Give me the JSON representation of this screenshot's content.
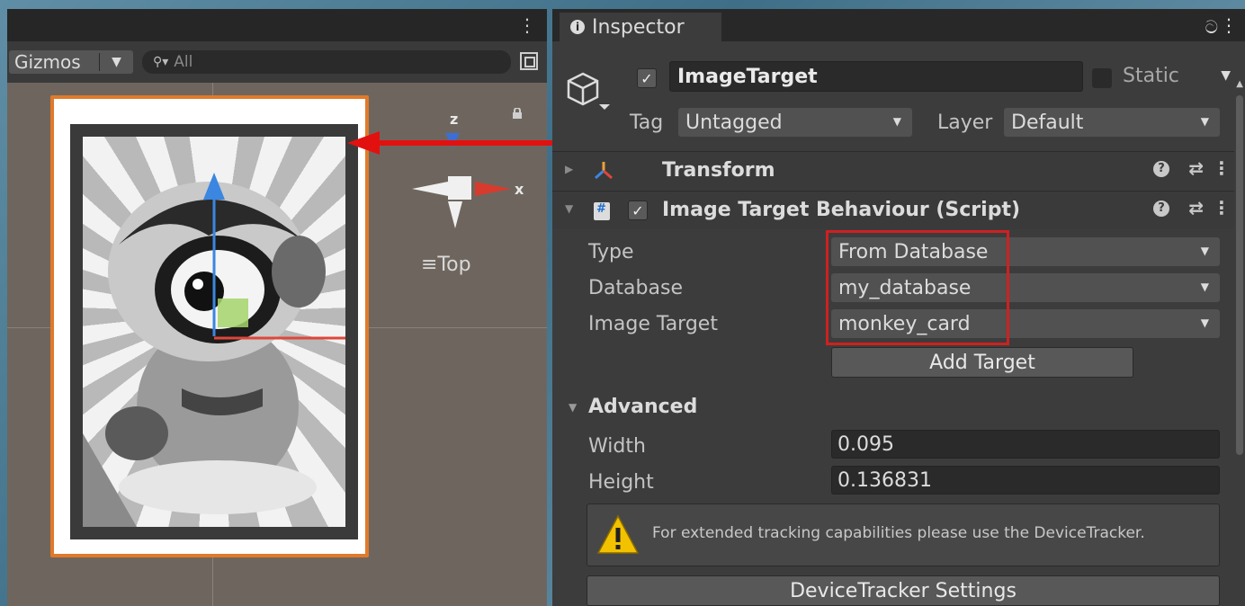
{
  "scene": {
    "gizmos_label": "Gizmos",
    "search_placeholder": "All",
    "view_label": "≡Top",
    "axis_z": "z",
    "axis_x": "x"
  },
  "inspector": {
    "tab_label": "Inspector",
    "object_name": "ImageTarget",
    "static_label": "Static",
    "tag_label": "Tag",
    "tag_value": "Untagged",
    "layer_label": "Layer",
    "layer_value": "Default"
  },
  "components": {
    "transform_title": "Transform",
    "itb_title": "Image Target Behaviour (Script)"
  },
  "image_target_behaviour": {
    "type_label": "Type",
    "type_value": "From Database",
    "database_label": "Database",
    "database_value": "my_database",
    "image_target_label": "Image Target",
    "image_target_value": "monkey_card",
    "add_target_label": "Add Target",
    "advanced_label": "Advanced",
    "width_label": "Width",
    "width_value": "0.095",
    "height_label": "Height",
    "height_value": "0.136831",
    "warning_text": "For extended tracking capabilities please use the DeviceTracker.",
    "devicetracker_button_label": "DeviceTracker Settings"
  },
  "colors": {
    "selection_outline": "#e07a2a",
    "annotation_red": "#e31010",
    "warning_yellow": "#f2c200"
  }
}
